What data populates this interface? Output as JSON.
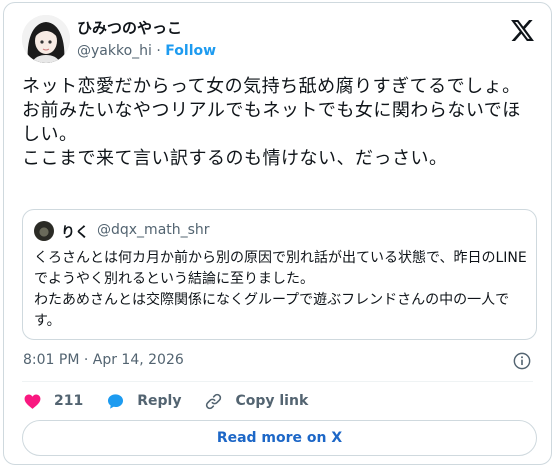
{
  "author": {
    "display_name": "ひみつのやっこ",
    "handle": "@yakko_hi",
    "separator": "·",
    "follow_label": "Follow"
  },
  "post": {
    "text": "ネット恋愛だからって女の気持ち舐め腐りすぎてるでしょ。\nお前みたいなやつリアルでもネットでも女に関わらないでほしい。\nここまで来て言い訳するのも情けない、だっさい。"
  },
  "quoted": {
    "display_name": "りく",
    "handle": "@dqx_math_shr",
    "text": "くろさんとは何カ月か前から別の原因で別れ話が出ている状態で、昨日のLINEでようやく別れるという結論に至りました。\nわたあめさんとは交際関係になくグループで遊ぶフレンドさんの中の一人です。"
  },
  "meta": {
    "timestamp": "8:01 PM · Apr 14, 2026"
  },
  "actions": {
    "like_count": "211",
    "reply_label": "Reply",
    "copy_label": "Copy link"
  },
  "footer": {
    "read_more_label": "Read more on X"
  },
  "colors": {
    "accent": "#1d9bf0",
    "like": "#f91880",
    "text_primary": "#0f1419",
    "text_secondary": "#536471",
    "border": "#cfd9de"
  }
}
